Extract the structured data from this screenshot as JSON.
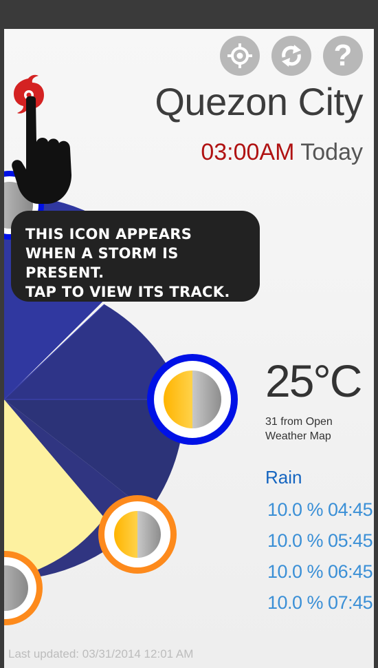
{
  "header": {
    "city": "Quezon City",
    "time": "03:00AM",
    "day": "Today"
  },
  "toolbar": {
    "icons": [
      "locate-icon",
      "refresh-icon",
      "help-icon"
    ],
    "help_symbol": "?"
  },
  "tooltip": {
    "text": "THIS ICON APPEARS\nWHEN A STORM IS PRESENT.\nTAP TO VIEW ITS TRACK."
  },
  "weather": {
    "temperature": "25°C",
    "source": "31 from Open\nWeather Map",
    "precip_label": "Rain",
    "forecast": [
      {
        "text": "10.0 % 04:45"
      },
      {
        "text": "10.0 % 05:45"
      },
      {
        "text": "10.0 % 06:45"
      },
      {
        "text": "10.0 % 07:45"
      }
    ]
  },
  "footer": {
    "last_updated": "Last updated: 03/31/2014 12:01 AM"
  },
  "colors": {
    "night_blue": "#2e347e",
    "day_yellow": "#fdf1a0",
    "ring_blue": "#0011e6",
    "ring_orange": "#fd8a1c",
    "accent_red": "#b01212",
    "link_blue": "#3a8fd6"
  }
}
